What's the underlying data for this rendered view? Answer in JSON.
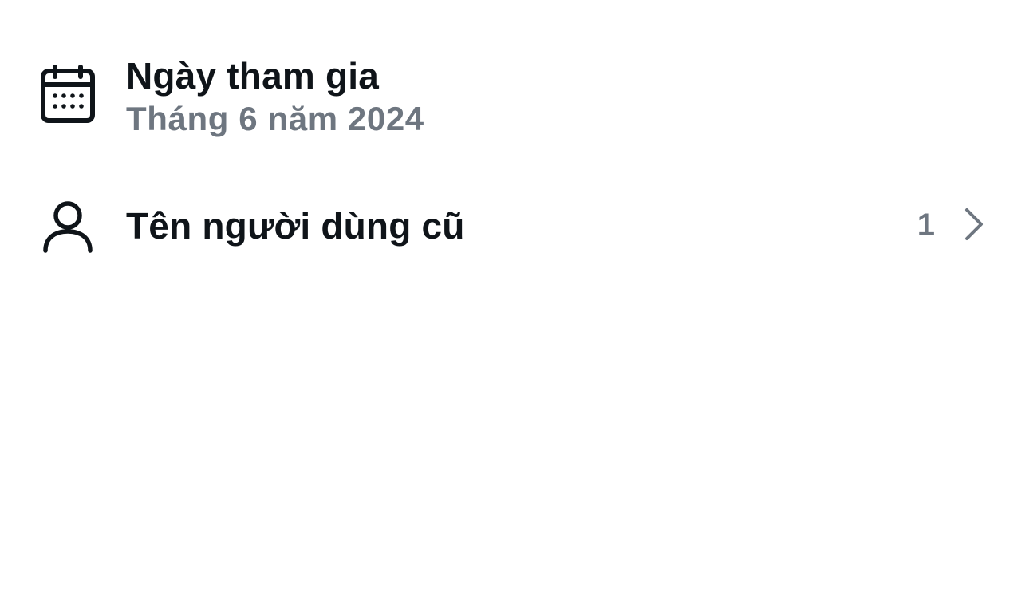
{
  "join_date": {
    "icon": "calendar-icon",
    "label": "Ngày tham gia",
    "value": "Tháng 6 năm 2024"
  },
  "previous_usernames": {
    "icon": "user-icon",
    "label": "Tên người dùng cũ",
    "count": "1",
    "trailing_icon": "chevron-right-icon"
  },
  "colors": {
    "primary_text": "#0f1419",
    "secondary_text": "#6e7680",
    "background": "#ffffff"
  }
}
